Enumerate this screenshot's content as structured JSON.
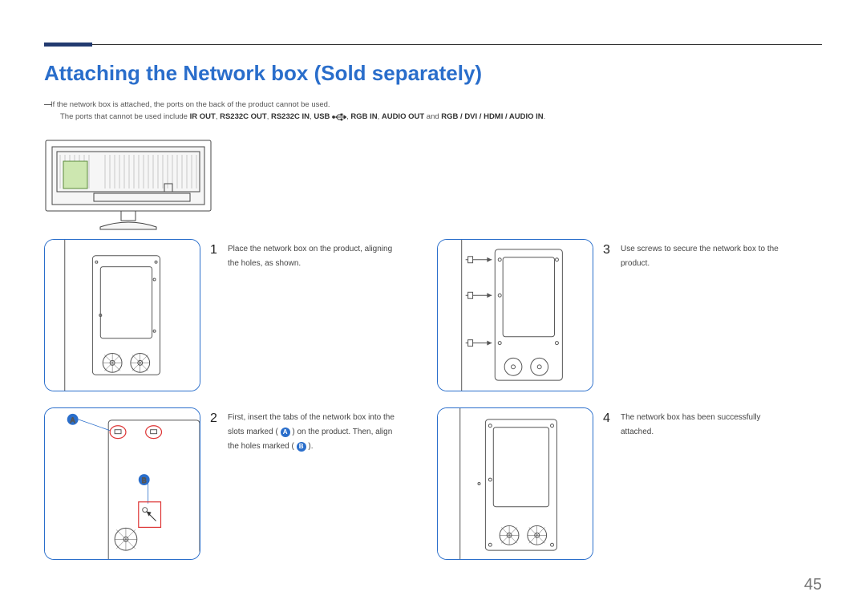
{
  "title": "Attaching the Network box (Sold separately)",
  "note_line1": "If the network box is attached, the ports on the back of the product cannot be used.",
  "note_line2_prefix": "The ports that cannot be used include ",
  "note_ports": {
    "p1": "IR OUT",
    "p2": "RS232C OUT",
    "p3": "RS232C IN",
    "p4": "USB",
    "p5": "RGB IN",
    "p6": "AUDIO OUT",
    "and": " and ",
    "p7": "RGB / DVI / HDMI / AUDIO IN",
    "comma": ", "
  },
  "steps": {
    "s1_num": "1",
    "s1_text": "Place the network box on the product, aligning the holes, as shown.",
    "s2_num": "2",
    "s2_text_a": "First, insert the tabs of the network box into the slots marked (",
    "s2_text_b": ") on the product. Then, align the holes marked (",
    "s2_text_c": ").",
    "s2_label_a": "A",
    "s2_label_b": "B",
    "s3_num": "3",
    "s3_text": "Use screws to secure the network box to the product.",
    "s4_num": "4",
    "s4_text": "The network box has been successfully attached."
  },
  "marks": {
    "A": "A",
    "B": "B"
  },
  "page_number": "45"
}
